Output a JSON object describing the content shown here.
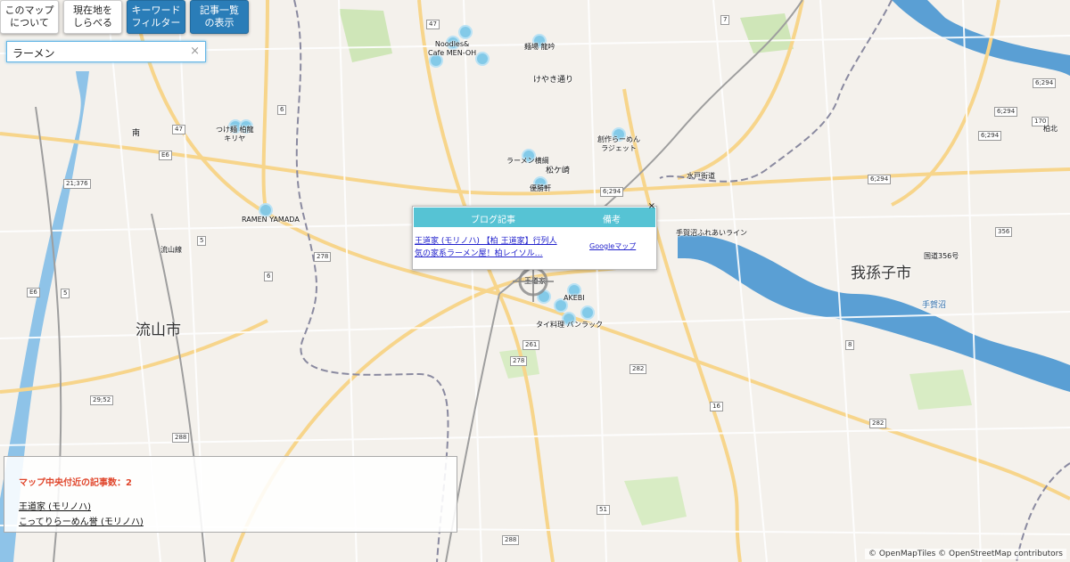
{
  "controls": {
    "about": "このマップ\nについて",
    "locate": "現在地を\nしらべる",
    "keyword_filter": "キーワード\nフィルター",
    "article_list": "記事一覧\nの表示"
  },
  "search": {
    "value": "ラーメン",
    "clear_icon": "×"
  },
  "places": {
    "nagareyama": "流山市",
    "abiko": "我孫子市",
    "matsugasaki": "松ケ崎",
    "teganuma": "手賀沼",
    "keyaki": "けやき通り",
    "minami": "南",
    "tegaoh": "手賀沼ふれあいライン",
    "route356": "国道356号",
    "mizuto": "水戸街道",
    "kashiwa_n": "柏北",
    "nagareyama_ln": "流山線"
  },
  "road_numbers": [
    "47",
    "47",
    "6",
    "E6",
    "21;376",
    "5",
    "278",
    "E6",
    "6",
    "6;294",
    "278",
    "7",
    "261",
    "282",
    "16",
    "8",
    "282",
    "288",
    "288",
    "51",
    "29;52",
    "356",
    "170",
    "6;294",
    "6;294",
    "6;294",
    "6;294",
    "5"
  ],
  "markers": [
    {
      "label": "Noodles&\nCafe MEN-OH"
    },
    {
      "label": "麺場 龍吟"
    },
    {
      "label": "つけ麺 柏龍\nキリヤ"
    },
    {
      "label": "創作らーめん\nラジェット"
    },
    {
      "label": "ラーメン横綱"
    },
    {
      "label": "優勝軒"
    },
    {
      "label": "RAMEN YAMADA"
    },
    {
      "label": "王道家"
    },
    {
      "label": "AKEBI"
    },
    {
      "label": "タイ料理 バンラック"
    }
  ],
  "popup": {
    "col_article": "ブログ記事",
    "col_note": "備考",
    "article_link": "王道家 (モリノハ) 【柏 王道家】行列人\n気の家系ラーメン屋！柏レイソル…",
    "note_link": "Googleマップ",
    "close": "×"
  },
  "panel": {
    "count_text": "マップ中央付近の記事数：2",
    "items": [
      "王道家 (モリノハ)",
      "こってりらーめん誉 (モリノハ)"
    ]
  },
  "attribution": "© OpenMapTiles © OpenStreetMap contributors",
  "colors": {
    "water": "#8ec3e8",
    "river": "#5a9fd4",
    "major_road": "#f7d58b",
    "button_blue": "#2a7db8",
    "popup_header": "#56c3d4",
    "marker": "#7ec8e8"
  }
}
